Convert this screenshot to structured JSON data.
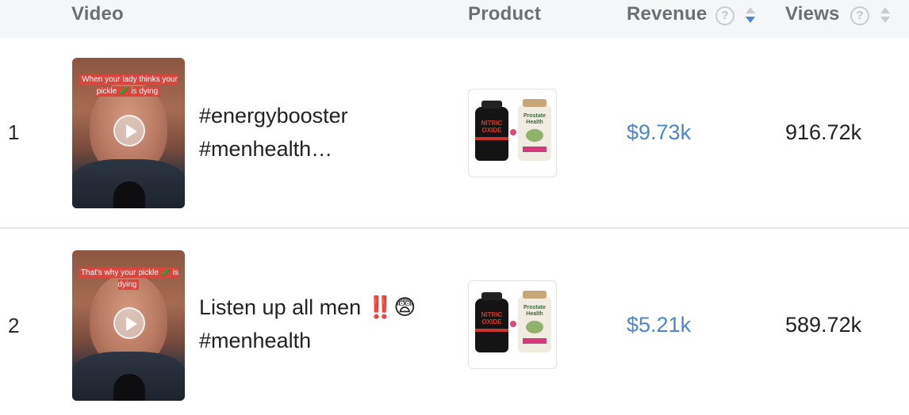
{
  "header": {
    "video_label": "Video",
    "product_label": "Product",
    "revenue_label": "Revenue",
    "views_label": "Views",
    "help_glyph": "?",
    "sort_active_color": "#4a86d6",
    "sort_inactive_color": "#c9cbd0"
  },
  "rows": [
    {
      "rank": "1",
      "thumbnail_caption": "When your lady thinks your pickle 🥒 is dying",
      "title_line1": "#energybooster",
      "title_line2": "#menhealth…",
      "revenue": "$9.73k",
      "views": "916.72k"
    },
    {
      "rank": "2",
      "thumbnail_caption": "That's why your pickle 🥒 is dying",
      "title_line1": "Listen up all men ‼️😨",
      "title_line2": "#menhealth",
      "revenue": "$5.21k",
      "views": "589.72k"
    }
  ],
  "product_image": {
    "bottle1_label": "NITRIC OXIDE",
    "bottle2_label": "Prostate Health"
  },
  "colors": {
    "revenue": "#4a86d6",
    "header_bg": "#f5f6f8",
    "caption_bg": "#d8463e"
  }
}
